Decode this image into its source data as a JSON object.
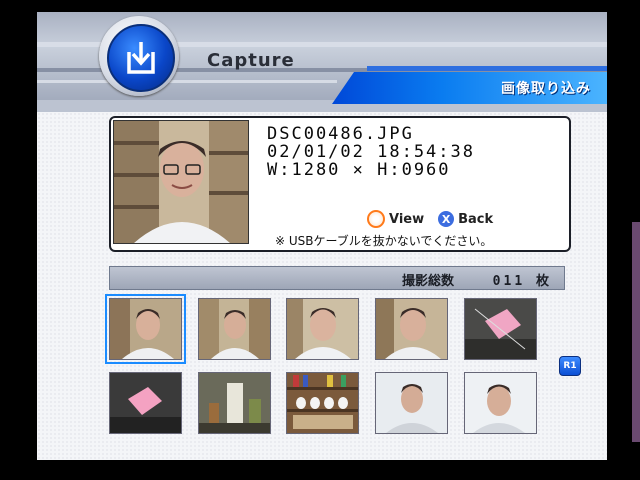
{
  "header": {
    "title": "Capture",
    "subtitle_jp": "画像取り込み",
    "icon": "download-tray-icon"
  },
  "photo": {
    "filename": "DSC00486.JPG",
    "datetime": "02/01/02 18:54:38",
    "dimensions": "W:1280 × H:0960"
  },
  "controls": {
    "view_label": "View",
    "back_label": "Back",
    "view_icon": "circle-button-icon",
    "back_icon": "cross-button-icon",
    "back_glyph": "X"
  },
  "warning": "※ USBケーブルを抜かないでください。",
  "counter": {
    "label": "撮影総数",
    "value": "011",
    "unit": "枚"
  },
  "thumbnails": [
    {
      "type": "portrait",
      "selected": true
    },
    {
      "type": "portrait",
      "selected": false
    },
    {
      "type": "portrait",
      "selected": false
    },
    {
      "type": "portrait",
      "selected": false
    },
    {
      "type": "pink-object",
      "selected": false
    },
    {
      "type": "pink-object",
      "selected": false
    },
    {
      "type": "shelf-figures",
      "selected": false
    },
    {
      "type": "bookcase",
      "selected": false
    },
    {
      "type": "portrait",
      "selected": false
    },
    {
      "type": "portrait",
      "selected": false
    }
  ],
  "page_badge": "R1",
  "colors": {
    "accent_blue": "#0a7cf0",
    "selection": "#1a8bff",
    "view_button": "#ff7a1a",
    "back_button": "#3c6de0"
  }
}
